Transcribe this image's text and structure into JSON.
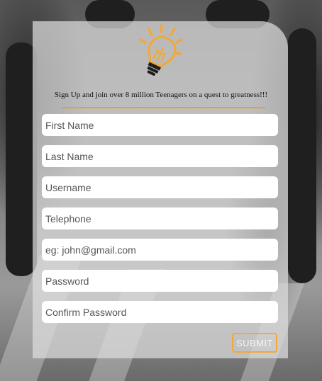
{
  "form": {
    "tagline": "Sign Up and join over 8 million Teenagers on a quest to greatness!!!",
    "fields": [
      {
        "placeholder": "First Name",
        "value": ""
      },
      {
        "placeholder": "Last Name",
        "value": ""
      },
      {
        "placeholder": "Username",
        "value": ""
      },
      {
        "placeholder": "Telephone",
        "value": ""
      },
      {
        "placeholder": "eg: john@gmail.com",
        "value": ""
      },
      {
        "placeholder": "Password",
        "value": ""
      },
      {
        "placeholder": "Confirm Password",
        "value": ""
      }
    ],
    "submit_label": "SUBMIT"
  },
  "logo": {
    "icon": "lightbulb-icon",
    "color": "#f0a93a"
  },
  "colors": {
    "accent": "#e2a132",
    "card_bg": "rgba(220,220,220,0.72)"
  }
}
